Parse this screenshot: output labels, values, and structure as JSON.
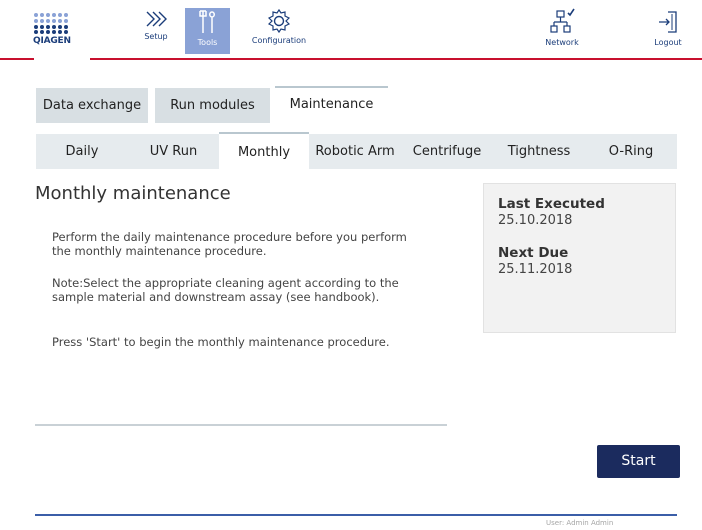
{
  "brand": {
    "name": "QIAGEN",
    "color_blue": "#1b3d7a",
    "color_red": "#c8102e"
  },
  "nav": {
    "setup": {
      "label": "Setup",
      "icon": "chevrons-right-icon"
    },
    "tools": {
      "label": "Tools",
      "icon": "tools-icon",
      "active": true
    },
    "configuration": {
      "label": "Configuration",
      "icon": "gear-icon"
    },
    "network": {
      "label": "Network",
      "icon": "network-icon"
    },
    "logout": {
      "label": "Logout",
      "icon": "logout-icon"
    }
  },
  "tabs_primary": [
    {
      "label": "Data exchange"
    },
    {
      "label": "Run modules"
    },
    {
      "label": "Maintenance",
      "active": true
    }
  ],
  "tabs_secondary": [
    {
      "label": "Daily"
    },
    {
      "label": "UV Run"
    },
    {
      "label": "Monthly",
      "active": true
    },
    {
      "label": "Robotic Arm"
    },
    {
      "label": "Centrifuge"
    },
    {
      "label": "Tightness"
    },
    {
      "label": "O-Ring"
    }
  ],
  "main": {
    "title": "Monthly maintenance",
    "paragraphs": [
      "Perform the daily maintenance procedure before you perform the monthly maintenance procedure.",
      "Note:Select the appropriate cleaning agent according to the sample material and downstream assay (see handbook).",
      "Press 'Start' to begin the monthly maintenance procedure."
    ]
  },
  "info": {
    "last_executed_label": "Last Executed",
    "last_executed_value": "25.10.2018",
    "next_due_label": "Next Due",
    "next_due_value": "25.11.2018"
  },
  "actions": {
    "start_label": "Start"
  },
  "footer": {
    "user": "User: Admin Admin"
  }
}
